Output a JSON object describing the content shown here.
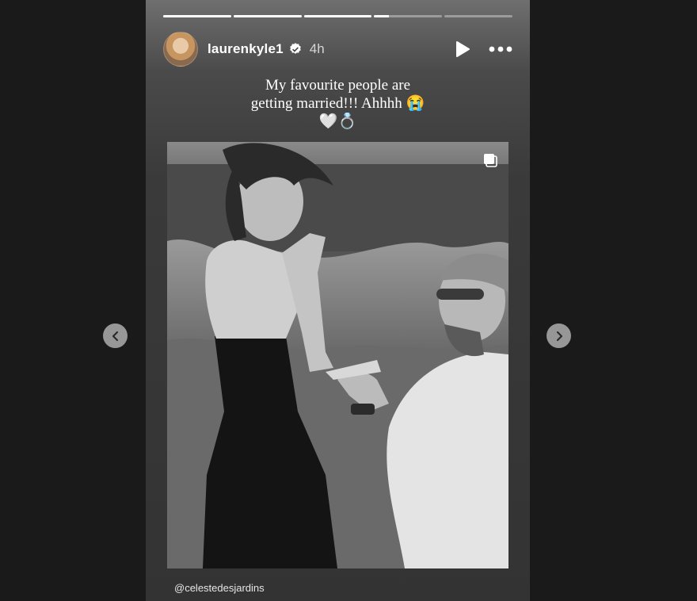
{
  "story": {
    "progress": [
      1,
      1,
      1,
      0.22,
      0
    ],
    "username": "laurenkyle1",
    "time": "4h",
    "caption_lines": [
      "My favourite people are",
      "getting married!!! Ahhhh 😭",
      "🤍💍"
    ],
    "mention": "@celestedesjardins"
  },
  "icons": {
    "verified": "verified-badge-icon",
    "play": "play-icon",
    "more": "more-options-icon",
    "prev": "chevron-left-icon",
    "next": "chevron-right-icon",
    "multi": "multiple-photos-icon"
  },
  "colors": {
    "page_bg": "#1a1a1a",
    "progress_active": "#ffffff",
    "text": "#ffffff"
  }
}
